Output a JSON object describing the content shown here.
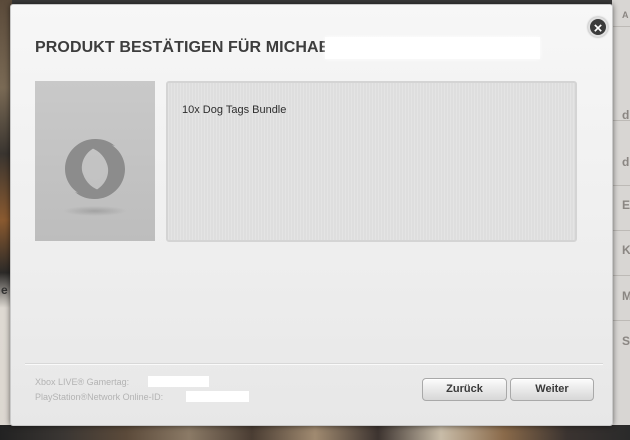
{
  "background": {
    "right_letters": [
      "A",
      "d",
      "d",
      "E",
      "K",
      "M",
      "S"
    ],
    "left_letter": "e"
  },
  "dialog": {
    "title": "PRODUKT BESTÄTIGEN FÜR MICHAE",
    "close_symbol": "×",
    "product": {
      "name": "10x Dog Tags Bundle",
      "image_icon": "origin-logo-icon"
    },
    "footer": {
      "xbox_label": "Xbox LIVE® Gamertag:",
      "psn_label": "PlayStation®Network Online-ID:"
    },
    "buttons": {
      "back": "Zurück",
      "next": "Weiter"
    }
  },
  "colors": {
    "dialog_bg": "#eeeeee",
    "title_text": "#3d3d3d",
    "close_button": "#3b3b3b",
    "image_placeholder": "#c3c3c3",
    "origin_logo": "#8c8c8c"
  }
}
